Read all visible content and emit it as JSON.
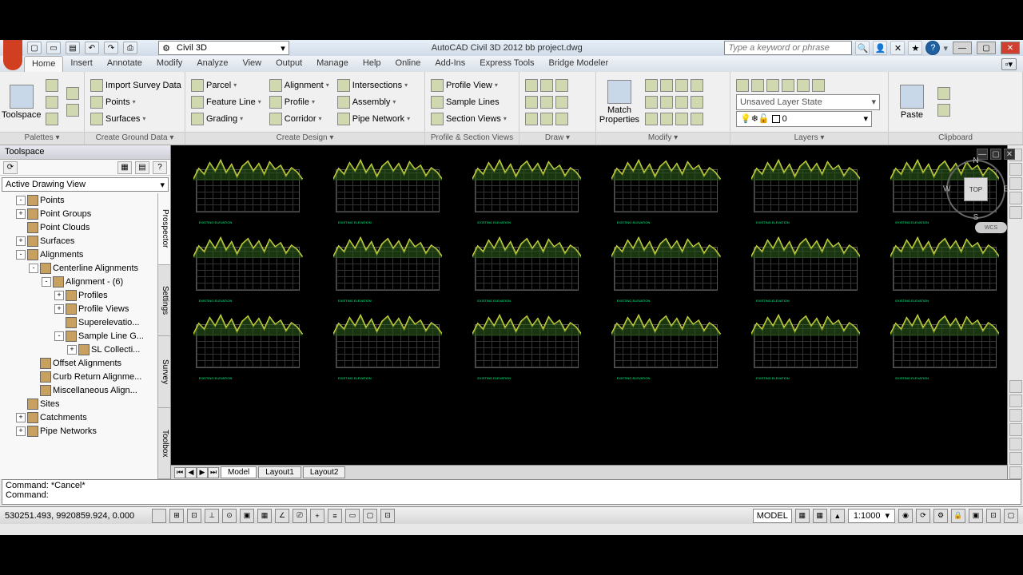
{
  "app": {
    "title": "AutoCAD Civil 3D 2012   bb project.dwg",
    "workspace": "Civil 3D",
    "search_placeholder": "Type a keyword or phrase"
  },
  "menu": {
    "tabs": [
      "Home",
      "Insert",
      "Annotate",
      "Modify",
      "Analyze",
      "View",
      "Output",
      "Manage",
      "Help",
      "Online",
      "Add-Ins",
      "Express Tools",
      "Bridge Modeler"
    ],
    "active": "Home"
  },
  "ribbon": {
    "palettes": {
      "label": "Palettes ▾",
      "big": "Toolspace"
    },
    "ground": {
      "label": "Create Ground Data ▾",
      "items": [
        "Import Survey Data",
        "Points",
        "Surfaces"
      ]
    },
    "design": {
      "label": "Create Design ▾",
      "col1": [
        "Parcel",
        "Feature Line",
        "Grading"
      ],
      "col2": [
        "Alignment",
        "Profile",
        "Corridor"
      ],
      "col3": [
        "Intersections",
        "Assembly",
        "Pipe Network"
      ]
    },
    "profile": {
      "label": "Profile & Section Views",
      "items": [
        "Profile View",
        "Sample Lines",
        "Section Views"
      ]
    },
    "draw": {
      "label": "Draw ▾"
    },
    "modify": {
      "label": "Modify ▾",
      "big": "Match\nProperties"
    },
    "layers": {
      "label": "Layers ▾",
      "state": "Unsaved Layer State",
      "current": "0"
    },
    "clipboard": {
      "label": "Clipboard",
      "big": "Paste"
    }
  },
  "toolspace": {
    "title": "Toolspace",
    "view": "Active Drawing View",
    "tabs": [
      "Prospector",
      "Settings",
      "Survey",
      "Toolbox"
    ],
    "tree": [
      {
        "indent": 1,
        "exp": "-",
        "label": "Points"
      },
      {
        "indent": 1,
        "exp": "+",
        "label": "Point Groups"
      },
      {
        "indent": 1,
        "exp": "",
        "label": "Point Clouds"
      },
      {
        "indent": 1,
        "exp": "+",
        "label": "Surfaces"
      },
      {
        "indent": 1,
        "exp": "-",
        "label": "Alignments"
      },
      {
        "indent": 2,
        "exp": "-",
        "label": "Centerline Alignments"
      },
      {
        "indent": 3,
        "exp": "-",
        "label": "Alignment - (6)"
      },
      {
        "indent": 4,
        "exp": "+",
        "label": "Profiles"
      },
      {
        "indent": 4,
        "exp": "+",
        "label": "Profile Views"
      },
      {
        "indent": 4,
        "exp": "",
        "label": "Superelevatio..."
      },
      {
        "indent": 4,
        "exp": "-",
        "label": "Sample Line G..."
      },
      {
        "indent": 5,
        "exp": "+",
        "label": "SL Collecti..."
      },
      {
        "indent": 2,
        "exp": "",
        "label": "Offset Alignments"
      },
      {
        "indent": 2,
        "exp": "",
        "label": "Curb Return Alignme..."
      },
      {
        "indent": 2,
        "exp": "",
        "label": "Miscellaneous Align..."
      },
      {
        "indent": 1,
        "exp": "",
        "label": "Sites"
      },
      {
        "indent": 1,
        "exp": "+",
        "label": "Catchments"
      },
      {
        "indent": 1,
        "exp": "+",
        "label": "Pipe Networks"
      }
    ]
  },
  "canvas": {
    "viewcube_face": "TOP",
    "wcs": "WCS",
    "section_label": "EXISTING ELEVATION"
  },
  "layout_tabs": [
    "Model",
    "Layout1",
    "Layout2"
  ],
  "command": {
    "line1": "Command: *Cancel*",
    "line2": "Command:"
  },
  "status": {
    "coords": "530251.493, 9920859.924, 0.000",
    "model": "MODEL",
    "scale": "1:1000"
  }
}
